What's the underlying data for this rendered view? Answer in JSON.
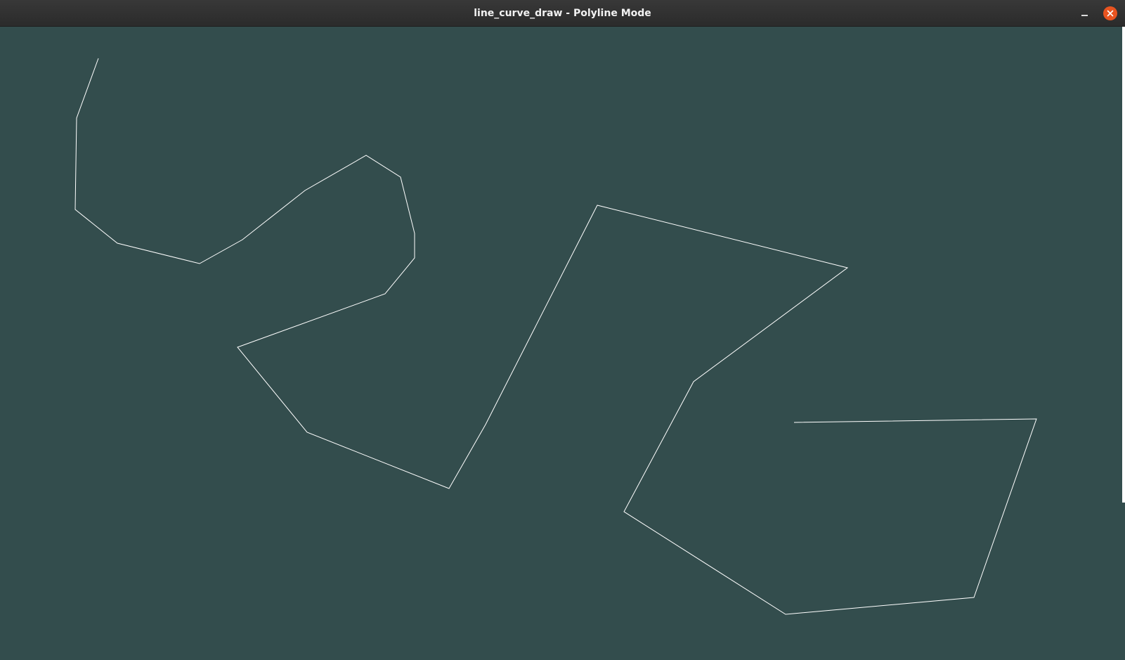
{
  "window": {
    "title": "line_curve_draw - Polyline Mode",
    "minimize_icon": "minimize-icon",
    "close_icon": "close-icon",
    "close_color": "#e95420"
  },
  "canvas": {
    "background_color": "#334d4d",
    "stroke_color": "#ffffff"
  }
}
